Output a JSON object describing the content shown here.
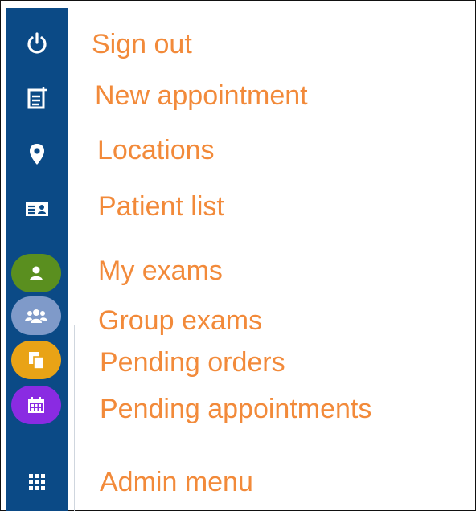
{
  "menu": {
    "items": [
      {
        "label": "Sign out",
        "icon": "power-icon"
      },
      {
        "label": "New appointment",
        "icon": "new-appointment-icon"
      },
      {
        "label": "Locations",
        "icon": "map-pin-icon"
      },
      {
        "label": "Patient list",
        "icon": "id-card-icon"
      },
      {
        "label": "My exams",
        "icon": "user-icon"
      },
      {
        "label": "Group exams",
        "icon": "group-icon"
      },
      {
        "label": "Pending orders",
        "icon": "documents-icon"
      },
      {
        "label": "Pending appointments",
        "icon": "calendar-icon"
      },
      {
        "label": "Admin menu",
        "icon": "grid-icon"
      }
    ]
  },
  "colors": {
    "sidebar": "#0b4a86",
    "label": "#f28a3a",
    "my_exams_pill": "#5a8f1f",
    "group_exams_pill": "#7f9ac9",
    "pending_orders_pill": "#e9a316",
    "pending_appointments_pill": "#8a2be2"
  }
}
